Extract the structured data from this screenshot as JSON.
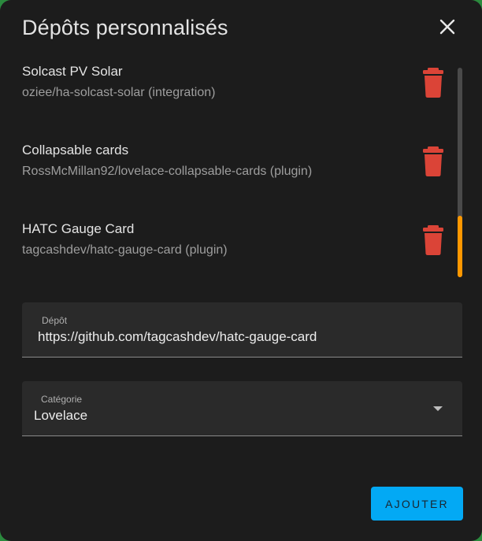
{
  "dialog": {
    "title": "Dépôts personnalisés",
    "close_icon": "close-icon"
  },
  "repositories": [
    {
      "name": "Solcast PV Solar",
      "detail": "oziee/ha-solcast-solar (integration)"
    },
    {
      "name": "Collapsable cards",
      "detail": "RossMcMillan92/lovelace-collapsable-cards (plugin)"
    },
    {
      "name": "HATC Gauge Card",
      "detail": "tagcashdev/hatc-gauge-card (plugin)"
    }
  ],
  "repository_field": {
    "label": "Dépôt",
    "value": "https://github.com/tagcashdev/hatc-gauge-card"
  },
  "category_field": {
    "label": "Catégorie",
    "value": "Lovelace"
  },
  "actions": {
    "add_label": "AJOUTER"
  },
  "colors": {
    "accent": "#03a9f4",
    "delete": "#db4437",
    "scroll_thumb": "#ff9800",
    "background": "#1c1c1c"
  }
}
